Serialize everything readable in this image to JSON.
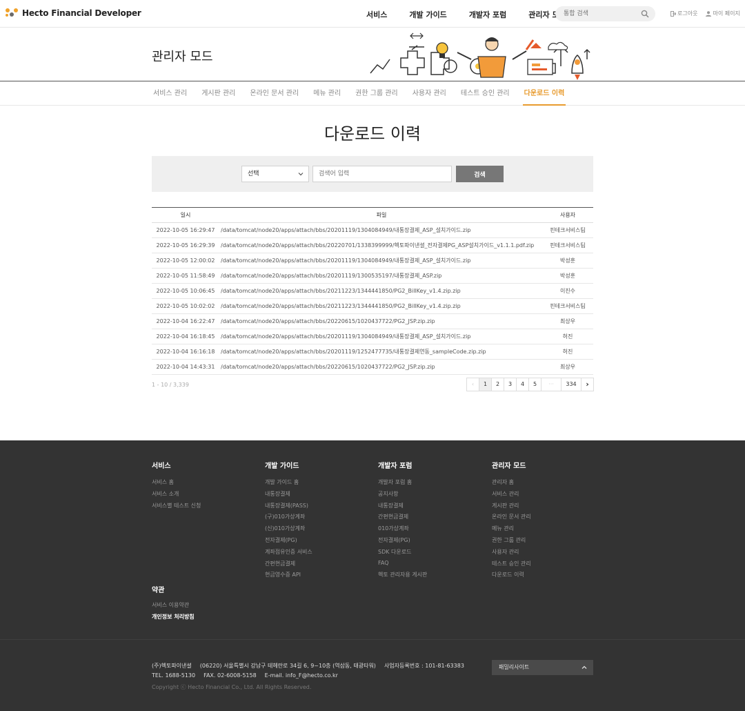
{
  "header": {
    "logo_text": "Hecto Financial Developer",
    "nav": [
      "서비스",
      "개발 가이드",
      "개발자 포럼",
      "관리자 모드"
    ],
    "search_placeholder": "통합 검색",
    "logout": "로그아웃",
    "mypage": "마이 페이지"
  },
  "banner": {
    "title": "관리자 모드"
  },
  "lnb": {
    "items": [
      "서비스 관리",
      "게시판 관리",
      "온라인 문서 관리",
      "메뉴 관리",
      "권한 그룹 관리",
      "사용자 관리",
      "테스트 승인 관리",
      "다운로드 이력"
    ],
    "active_index": 7
  },
  "page_title": "다운로드 이력",
  "search": {
    "select_value": "선택",
    "keyword_placeholder": "검색어 입력",
    "button": "검색"
  },
  "table": {
    "headers": [
      "일시",
      "파일",
      "사용자"
    ],
    "rows": [
      [
        "2022-10-05 16:29:47",
        "/data/tomcat/node20/apps/attach/bbs/20201119/1304084949/내통장결제_ASP_설치가이드.zip",
        "핀테크서비스팀"
      ],
      [
        "2022-10-05 16:29:39",
        "/data/tomcat/node20/apps/attach/bbs/20220701/1338399999/헥토파이낸셜_전자결제PG_ASP설치가이드_v1.1.1.pdf.zip",
        "핀테크서비스팀"
      ],
      [
        "2022-10-05 12:00:02",
        "/data/tomcat/node20/apps/attach/bbs/20201119/1304084949/내통장결제_ASP_설치가이드.zip",
        "박성훈"
      ],
      [
        "2022-10-05 11:58:49",
        "/data/tomcat/node20/apps/attach/bbs/20201119/1300535197/내통장결제_ASP.zip",
        "박성훈"
      ],
      [
        "2022-10-05 10:06:45",
        "/data/tomcat/node20/apps/attach/bbs/20211223/1344441850/PG2_BillKey_v1.4.zip.zip",
        "이진수"
      ],
      [
        "2022-10-05 10:02:02",
        "/data/tomcat/node20/apps/attach/bbs/20211223/1344441850/PG2_BillKey_v1.4.zip.zip",
        "핀테크서비스팀"
      ],
      [
        "2022-10-04 16:22:47",
        "/data/tomcat/node20/apps/attach/bbs/20220615/1020437722/PG2_JSP.zip.zip",
        "최상우"
      ],
      [
        "2022-10-04 16:18:45",
        "/data/tomcat/node20/apps/attach/bbs/20201119/1304084949/내통장결제_ASP_설치가이드.zip",
        "허진"
      ],
      [
        "2022-10-04 16:16:18",
        "/data/tomcat/node20/apps/attach/bbs/20201119/1252477735/내통장결제연동_sampleCode.zip.zip",
        "허진"
      ],
      [
        "2022-10-04 14:43:31",
        "/data/tomcat/node20/apps/attach/bbs/20220615/1020437722/PG2_JSP.zip.zip",
        "최상우"
      ]
    ]
  },
  "pagination": {
    "summary": "1 - 10 / 3,339",
    "prev": "‹",
    "pages": [
      "1",
      "2",
      "3",
      "4",
      "5"
    ],
    "ellipsis": "···",
    "last": "334",
    "next": "›",
    "current": "1"
  },
  "footer": {
    "columns": [
      {
        "title": "서비스",
        "items": [
          "서비스 홈",
          "서비스 소개",
          "서비스별 테스트 신청"
        ]
      },
      {
        "title": "개발 가이드",
        "items": [
          "개발 가이드 홈",
          "내통장결제",
          "내통장결제(PASS)",
          "(구)010가상계좌",
          "(신)010가상계좌",
          "전자결제(PG)",
          "계좌점유인증 서비스",
          "간편현금결제",
          "현금영수증 API"
        ]
      },
      {
        "title": "개발자 포럼",
        "items": [
          "개발자 포럼 홈",
          "공지사항",
          "내통장결제",
          "간편현금결제",
          "010가상계좌",
          "전자결제(PG)",
          "SDK 다운로드",
          "FAQ",
          "헥토 관리자용 게시판"
        ]
      },
      {
        "title": "관리자 모드",
        "items": [
          "관리자 홈",
          "서비스 관리",
          "게시판 관리",
          "온라인 문서 관리",
          "메뉴 관리",
          "권한 그룹 관리",
          "사용자 관리",
          "테스트 승인 관리",
          "다운로드 이력"
        ]
      }
    ],
    "terms_title": "약관",
    "terms": [
      "서비스 이용약관",
      "개인정보 처리방침"
    ],
    "company": "(주)헥토파이낸셜",
    "address": "(06220) 서울특별시 강남구 테헤란로 34길 6, 9~10층 (역삼동, 태광타워)",
    "bizno": "사업자등록번호 : 101-81-63383",
    "tel": "TEL. 1688-5130",
    "fax": "FAX. 02-6008-5158",
    "email": "E-mail. info_F@hecto.co.kr",
    "copyright": "Copyright ⓒ Hecto Financial Co., Ltd. All Rights Reserved.",
    "family_site": "패밀리사이트"
  }
}
